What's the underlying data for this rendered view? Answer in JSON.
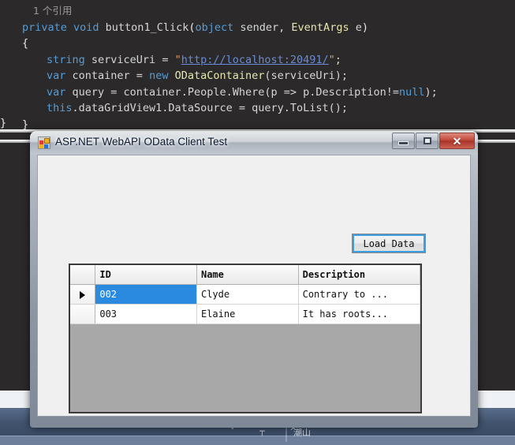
{
  "editor": {
    "reference_hint": "1 个引用",
    "code_lines": [
      {
        "tokens": [
          {
            "t": "private ",
            "c": "kw"
          },
          {
            "t": "void ",
            "c": "kw"
          },
          {
            "t": "button1_Click",
            "c": "plain"
          },
          {
            "t": "(",
            "c": "brace"
          },
          {
            "t": "object",
            "c": "kw"
          },
          {
            "t": " sender, ",
            "c": "plain"
          },
          {
            "t": "EventArgs",
            "c": "type"
          },
          {
            "t": " e",
            "c": "plain"
          },
          {
            "t": ")",
            "c": "brace"
          }
        ],
        "indent": 0
      },
      {
        "tokens": [
          {
            "t": "{",
            "c": "brace"
          }
        ],
        "indent": 0
      },
      {
        "tokens": [
          {
            "t": "string",
            "c": "kw"
          },
          {
            "t": " serviceUri = ",
            "c": "plain"
          },
          {
            "t": "\"",
            "c": "str"
          },
          {
            "t": "http://localhost:20491/",
            "c": "link"
          },
          {
            "t": "\"",
            "c": "str"
          },
          {
            "t": ";",
            "c": "plain"
          }
        ],
        "indent": 1
      },
      {
        "tokens": [
          {
            "t": "var",
            "c": "kw"
          },
          {
            "t": " container = ",
            "c": "plain"
          },
          {
            "t": "new",
            "c": "kw"
          },
          {
            "t": " ",
            "c": "plain"
          },
          {
            "t": "ODataContainer",
            "c": "type"
          },
          {
            "t": "(serviceUri);",
            "c": "plain"
          }
        ],
        "indent": 1
      },
      {
        "tokens": [
          {
            "t": "var",
            "c": "kw"
          },
          {
            "t": " query = container.People.Where(p => p.Description!=",
            "c": "plain"
          },
          {
            "t": "null",
            "c": "kw"
          },
          {
            "t": ");",
            "c": "plain"
          }
        ],
        "indent": 1
      },
      {
        "tokens": [
          {
            "t": "this",
            "c": "kw"
          },
          {
            "t": ".dataGridView1.DataSource = query.ToList();",
            "c": "plain"
          }
        ],
        "indent": 1
      },
      {
        "tokens": [
          {
            "t": "}",
            "c": "brace"
          }
        ],
        "indent": 0
      }
    ],
    "outer_brace": "}"
  },
  "dialog": {
    "title": "ASP.NET WebAPI OData Client Test",
    "icon_name": "winforms-app-icon",
    "window_buttons": {
      "minimize_label": "Minimize",
      "maximize_label": "Maximize",
      "close_label": "✕"
    },
    "load_button_label": "Load Data",
    "grid": {
      "columns": [
        "",
        "ID",
        "Name",
        "Description"
      ],
      "rows": [
        {
          "indicator": true,
          "id": "002",
          "name": "Clyde",
          "description": "Contrary to ...",
          "selected": true
        },
        {
          "indicator": false,
          "id": "003",
          "name": "Elaine",
          "description": "It has roots...",
          "selected": false
        }
      ]
    }
  },
  "taskbar": {
    "glyphs": "˅ ┬ ^",
    "label": "潮山"
  },
  "colors": {
    "selection_blue": "#2a8ae0",
    "editor_background": "#2b2929",
    "keyword_blue": "#569cd6",
    "type_yellow": "#e6e6b0",
    "string_orange": "#d69d6a",
    "link_blue": "#6a8cd6",
    "dialog_client": "#f0f0f0",
    "grid_empty_gray": "#a8a8a8",
    "close_red": "#c0483a"
  }
}
